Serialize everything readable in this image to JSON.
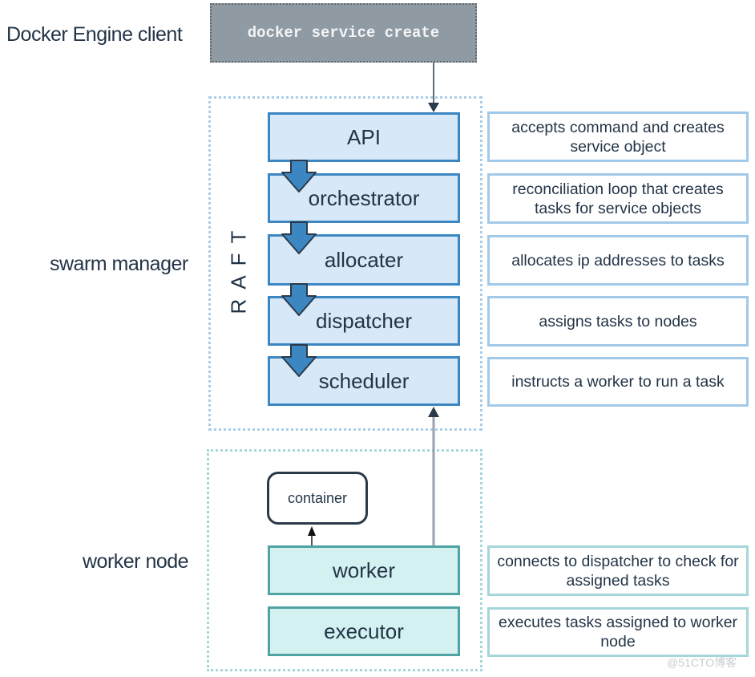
{
  "labels": {
    "client": "Docker Engine client",
    "manager": "swarm manager",
    "worker_node": "worker node",
    "raft": "RAFT"
  },
  "client_command": "docker service create",
  "manager_components": [
    {
      "name": "API",
      "description": "accepts command and creates service object"
    },
    {
      "name": "orchestrator",
      "description": "reconciliation loop that creates tasks for service objects"
    },
    {
      "name": "allocater",
      "description": "allocates ip addresses to tasks"
    },
    {
      "name": "dispatcher",
      "description": "assigns tasks to nodes"
    },
    {
      "name": "scheduler",
      "description": "instructs a worker to run a task"
    }
  ],
  "worker_components": [
    {
      "name": "worker",
      "description": "connects to dispatcher to check for assigned tasks"
    },
    {
      "name": "executor",
      "description": "executes tasks assigned to worker node"
    }
  ],
  "container_label": "container",
  "watermark": "@51CTO博客",
  "colors": {
    "manager_border": "#3c86c2",
    "manager_fill": "#d7e9f8",
    "worker_border": "#4fa3a3",
    "worker_fill": "#d4f1f1",
    "flow_arrow": "#3c86c2",
    "client_fill": "#8f9aa3"
  }
}
